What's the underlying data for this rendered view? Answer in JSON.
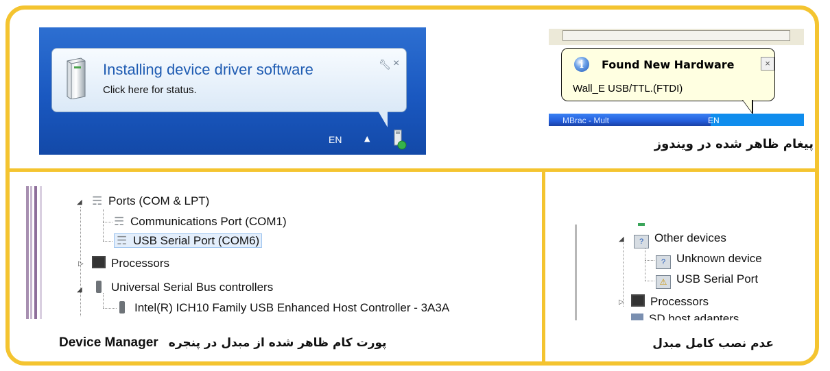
{
  "win7_balloon": {
    "title": "Installing device driver software",
    "subtitle": "Click here for status.",
    "wrench_icon": "wrench-icon",
    "close_glyph": "×",
    "tray_language": "EN",
    "tray_arrow": "▲"
  },
  "winxp_balloon": {
    "title": "Found New Hardware",
    "message": "Wall_E USB/TTL.(FTDI)",
    "close_glyph": "×",
    "info_glyph": "i",
    "taskbar_item": "MBrac - Mult",
    "tray_language": "EN"
  },
  "caption_windows": "پیغام ظاهر شده در ویندوز",
  "device_manager_ok": {
    "items": [
      {
        "label": "Ports (COM & LPT)",
        "icon": "port-icon",
        "expanded": true
      },
      {
        "label": "Communications Port (COM1)",
        "icon": "port-icon"
      },
      {
        "label": "USB Serial Port (COM6)",
        "icon": "port-icon",
        "selected": true
      },
      {
        "label": "Processors",
        "icon": "processor-icon",
        "expanded": false
      },
      {
        "label": "Universal Serial Bus controllers",
        "icon": "usb-icon",
        "expanded": true
      },
      {
        "label": "Intel(R) ICH10 Family USB Enhanced Host Controller - 3A3A",
        "icon": "usb-icon"
      }
    ],
    "caption_fa": "پورت کام ظاهر شده از مبدل در پنجره",
    "caption_en": "Device Manager"
  },
  "device_manager_fail": {
    "items": [
      {
        "label": "Other devices",
        "icon": "unknown-device-icon",
        "expanded": true
      },
      {
        "label": "Unknown device",
        "icon": "unknown-device-icon"
      },
      {
        "label": "USB Serial Port",
        "icon": "warning-device-icon"
      },
      {
        "label": "Processors",
        "icon": "processor-icon",
        "expanded": false
      },
      {
        "label": "SD host adapters",
        "icon": "sd-icon"
      }
    ],
    "caption_fa": "عدم نصب کامل مبدل"
  },
  "colors": {
    "frame": "#f4c430",
    "win7_taskbar": "#1a58c0",
    "win7_title": "#1e5bb2",
    "xp_balloon": "#ffffe1",
    "selection": "#e3eefb"
  }
}
